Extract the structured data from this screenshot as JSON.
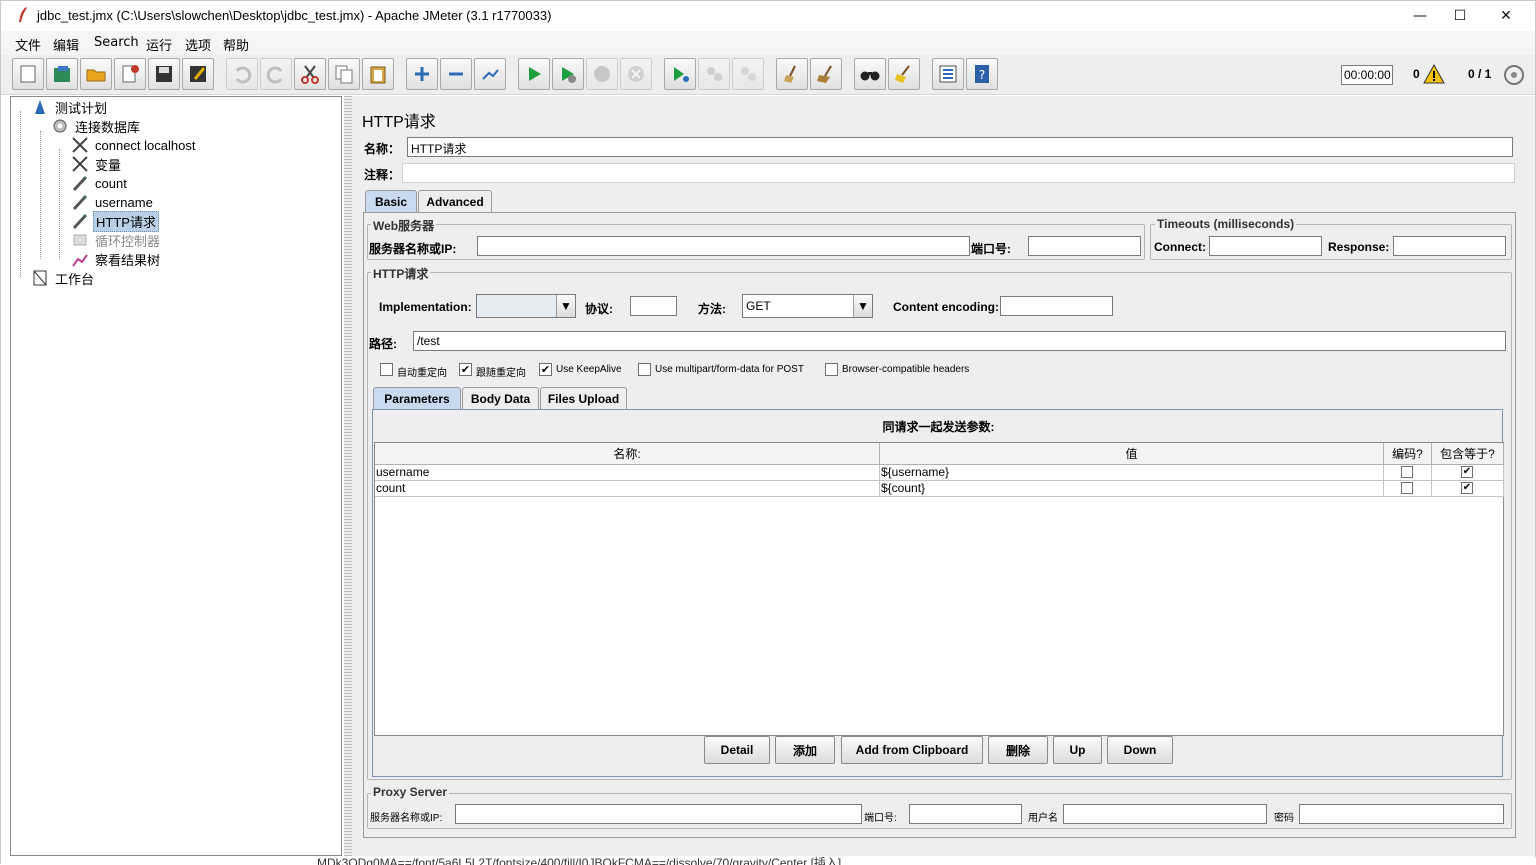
{
  "window": {
    "title": "jdbc_test.jmx (C:\\Users\\slowchen\\Desktop\\jdbc_test.jmx) - Apache JMeter (3.1 r1770033)",
    "minimize": "—",
    "maximize": "☐",
    "close": "✕"
  },
  "menu": [
    "文件",
    "编辑",
    "Search",
    "运行",
    "选项",
    "帮助"
  ],
  "toolbar": {
    "timer": "00:00:00",
    "error_count": "0",
    "threads": "0 / 1"
  },
  "tree": {
    "nodes": [
      {
        "label": "测试计划",
        "icon": "test-plan-icon"
      },
      {
        "label": "连接数据库",
        "icon": "thread-group-icon"
      },
      {
        "label": "connect localhost",
        "icon": "config-tools-icon"
      },
      {
        "label": "变量",
        "icon": "config-tools-icon"
      },
      {
        "label": "count",
        "icon": "sampler-icon"
      },
      {
        "label": "username",
        "icon": "sampler-icon"
      },
      {
        "label": "HTTP请求",
        "icon": "sampler-icon"
      },
      {
        "label": "循环控制器",
        "icon": "loop-controller-icon"
      },
      {
        "label": "察看结果树",
        "icon": "listener-icon"
      },
      {
        "label": "工作台",
        "icon": "workbench-icon"
      }
    ]
  },
  "panel": {
    "title": "HTTP请求",
    "name_label": "名称：",
    "name_value": "HTTP请求",
    "comment_label": "注释：",
    "tabs": [
      "Basic",
      "Advanced"
    ],
    "web_server": {
      "title": "Web服务器",
      "server_label": "服务器名称或IP:",
      "server_value": "",
      "port_label": "端口号:",
      "port_value": ""
    },
    "timeouts": {
      "title": "Timeouts (milliseconds)",
      "connect_label": "Connect:",
      "connect_value": "",
      "response_label": "Response:",
      "response_value": ""
    },
    "http_request": {
      "title": "HTTP请求",
      "implementation_label": "Implementation:",
      "implementation_value": "",
      "protocol_label": "协议:",
      "protocol_value": "",
      "method_label": "方法:",
      "method_value": "GET",
      "encoding_label": "Content encoding:",
      "encoding_value": "",
      "path_label": "路径:",
      "path_value": "/test"
    },
    "options": [
      {
        "label": "自动重定向",
        "checked": false
      },
      {
        "label": "跟随重定向",
        "checked": true
      },
      {
        "label": "Use KeepAlive",
        "checked": true
      },
      {
        "label": "Use multipart/form-data for POST",
        "checked": false
      },
      {
        "label": "Browser-compatible headers",
        "checked": false
      }
    ],
    "sub_tabs": [
      "Parameters",
      "Body Data",
      "Files Upload"
    ],
    "params": {
      "title": "同请求一起发送参数:",
      "headers": [
        "名称:",
        "值",
        "编码?",
        "包含等于?"
      ],
      "rows": [
        {
          "name": "username",
          "value": "${username}",
          "encode": false,
          "include_equals": true
        },
        {
          "name": "count",
          "value": "${count}",
          "encode": false,
          "include_equals": true
        }
      ]
    },
    "buttons": [
      "Detail",
      "添加",
      "Add from Clipboard",
      "删除",
      "Up",
      "Down"
    ],
    "proxy": {
      "title": "Proxy Server",
      "server_label": "服务器名称或IP:",
      "port_label": "端口号:",
      "user_label": "用户名",
      "password_label": "密码"
    }
  },
  "bottom_strip": "MDk3ODg0MA==/font/5a6L5L2T/fontsize/400/fill/I0JBQkFCMA==/dissolve/70/gravity/Center  [插入]"
}
